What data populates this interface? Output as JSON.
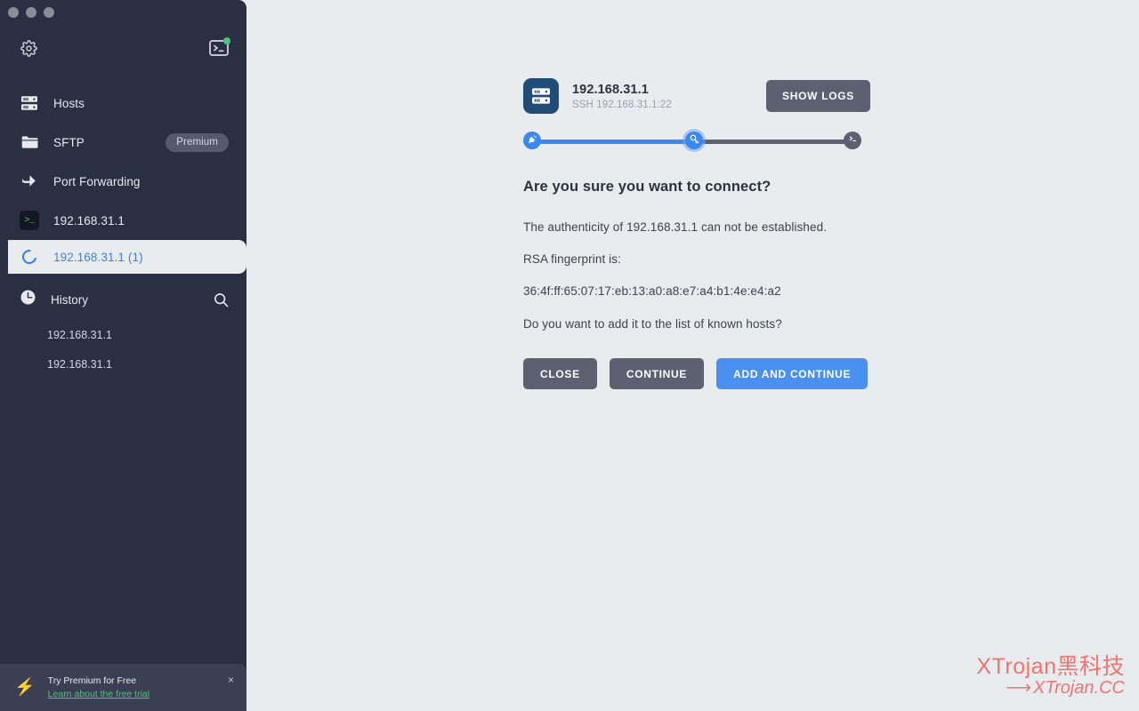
{
  "window": {
    "traffic_lights": [
      "close",
      "minimize",
      "maximize"
    ]
  },
  "sidebar": {
    "toolbar": {
      "settings_icon": "gear-icon",
      "terminal_icon": "terminal-icon",
      "terminal_badge": "online-dot"
    },
    "nav": [
      {
        "label": "Hosts",
        "icon": "server-rack-icon",
        "badge": ""
      },
      {
        "label": "SFTP",
        "icon": "folder-icon",
        "badge": "Premium"
      },
      {
        "label": "Port Forwarding",
        "icon": "arrow-right-icon",
        "badge": ""
      }
    ],
    "sessions": [
      {
        "label": "192.168.31.1",
        "icon": "terminal-prompt-icon",
        "active": false
      },
      {
        "label": "192.168.31.1 (1)",
        "icon": "spinner-icon",
        "active": true
      }
    ],
    "history": {
      "label": "History",
      "icon": "clock-icon",
      "search_icon": "search-icon",
      "items": [
        "192.168.31.1",
        "192.168.31.1"
      ]
    },
    "promo": {
      "icon": "lightning-bolt-icon",
      "title": "Try Premium for Free",
      "link": "Learn about the free trial",
      "close": "×"
    }
  },
  "main": {
    "host": {
      "icon": "server-rack-icon",
      "name": "192.168.31.1",
      "subtitle": "SSH 192.168.31.1:22"
    },
    "show_logs_label": "SHOW LOGS",
    "steps": [
      {
        "name": "connect-step",
        "icon": "plug-icon",
        "state": "done"
      },
      {
        "name": "authenticate-step",
        "icon": "key-icon",
        "state": "current"
      },
      {
        "name": "shell-step",
        "icon": "terminal-prompt-icon",
        "state": "pending"
      }
    ],
    "dialog": {
      "title": "Are you sure you want to connect?",
      "line1": "The authenticity of 192.168.31.1 can not be established.",
      "line2": "RSA fingerprint is:",
      "fingerprint": "36:4f:ff:65:07:17:eb:13:a0:a8:e7:a4:b1:4e:e4:a2",
      "line4": "Do you want to add it to the list of known hosts?",
      "buttons": {
        "close": "CLOSE",
        "continue": "CONTINUE",
        "add_and_continue": "ADD AND CONTINUE"
      }
    }
  },
  "watermark": {
    "line1": "XTrojan黑科技",
    "arrow": "⟶",
    "line2": "XTrojan.CC"
  },
  "colors": {
    "sidebar_bg": "#2a2f43",
    "content_bg": "#e9ecef",
    "accent_blue": "#4a90f0",
    "grey_button": "#5c6070",
    "green": "#4fc27b",
    "watermark_red": "#f4726f"
  }
}
